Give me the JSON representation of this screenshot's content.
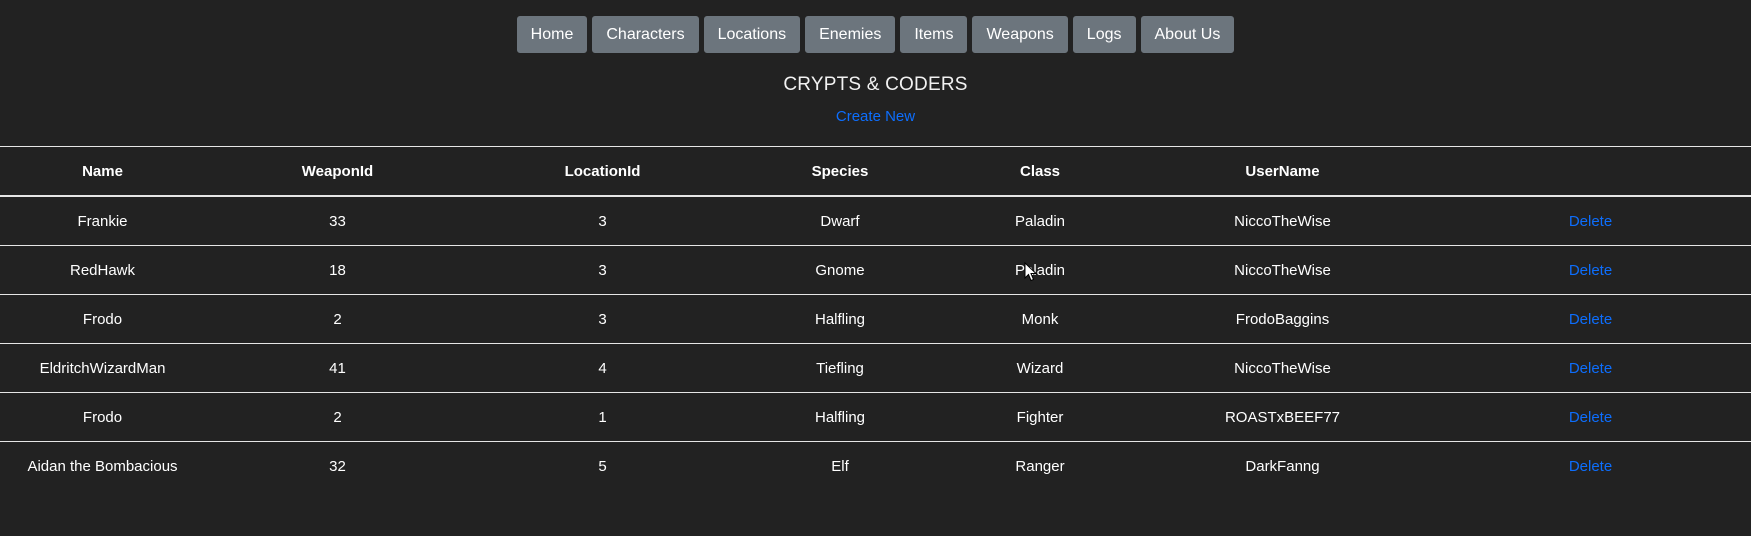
{
  "nav": {
    "items": [
      {
        "label": "Home"
      },
      {
        "label": "Characters"
      },
      {
        "label": "Locations"
      },
      {
        "label": "Enemies"
      },
      {
        "label": "Items"
      },
      {
        "label": "Weapons"
      },
      {
        "label": "Logs"
      },
      {
        "label": "About Us"
      }
    ]
  },
  "header": {
    "title": "CRYPTS & CODERS",
    "create_new": "Create New"
  },
  "table": {
    "columns": [
      "Name",
      "WeaponId",
      "LocationId",
      "Species",
      "Class",
      "UserName",
      ""
    ],
    "delete_label": "Delete",
    "rows": [
      {
        "name": "Frankie",
        "weaponId": "33",
        "locationId": "3",
        "species": "Dwarf",
        "class": "Paladin",
        "userName": "NiccoTheWise"
      },
      {
        "name": "RedHawk",
        "weaponId": "18",
        "locationId": "3",
        "species": "Gnome",
        "class": "Paladin",
        "userName": "NiccoTheWise"
      },
      {
        "name": "Frodo",
        "weaponId": "2",
        "locationId": "3",
        "species": "Halfling",
        "class": "Monk",
        "userName": "FrodoBaggins"
      },
      {
        "name": "EldritchWizardMan",
        "weaponId": "41",
        "locationId": "4",
        "species": "Tiefling",
        "class": "Wizard",
        "userName": "NiccoTheWise"
      },
      {
        "name": "Frodo",
        "weaponId": "2",
        "locationId": "1",
        "species": "Halfling",
        "class": "Fighter",
        "userName": "ROASTxBEEF77"
      },
      {
        "name": "Aidan the Bombacious",
        "weaponId": "32",
        "locationId": "5",
        "species": "Elf",
        "class": "Ranger",
        "userName": "DarkFanng"
      }
    ]
  },
  "colors": {
    "background": "#222222",
    "nav_button": "#6c757d",
    "link": "#0d6efd",
    "text": "#ffffff"
  },
  "icons": {
    "cursor": "mouse-pointer-icon"
  }
}
